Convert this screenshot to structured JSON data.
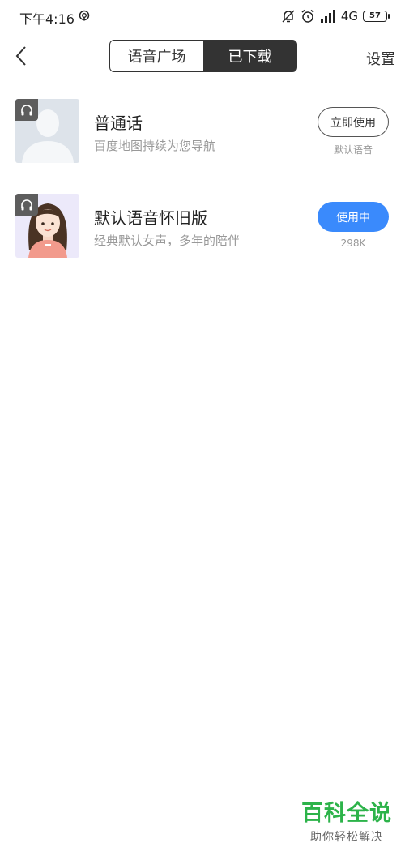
{
  "status_bar": {
    "time": "下午4:16",
    "network": "4G",
    "battery": "57"
  },
  "header": {
    "tabs": [
      {
        "label": "语音广场",
        "active": false
      },
      {
        "label": "已下载",
        "active": true
      }
    ],
    "settings_label": "设置"
  },
  "voices": [
    {
      "title": "普通话",
      "description": "百度地图持续为您导航",
      "action_label": "立即使用",
      "action_style": "outline",
      "sub_label": "默认语音"
    },
    {
      "title": "默认语音怀旧版",
      "description": "经典默认女声，多年的陪伴",
      "action_label": "使用中",
      "action_style": "filled",
      "sub_label": "298K"
    }
  ],
  "watermark": {
    "title": "百科全说",
    "subtitle": "助你轻松解决"
  },
  "colors": {
    "accent_blue": "#3a8afc",
    "watermark_green": "#2db34a",
    "segment_active": "#333333"
  }
}
